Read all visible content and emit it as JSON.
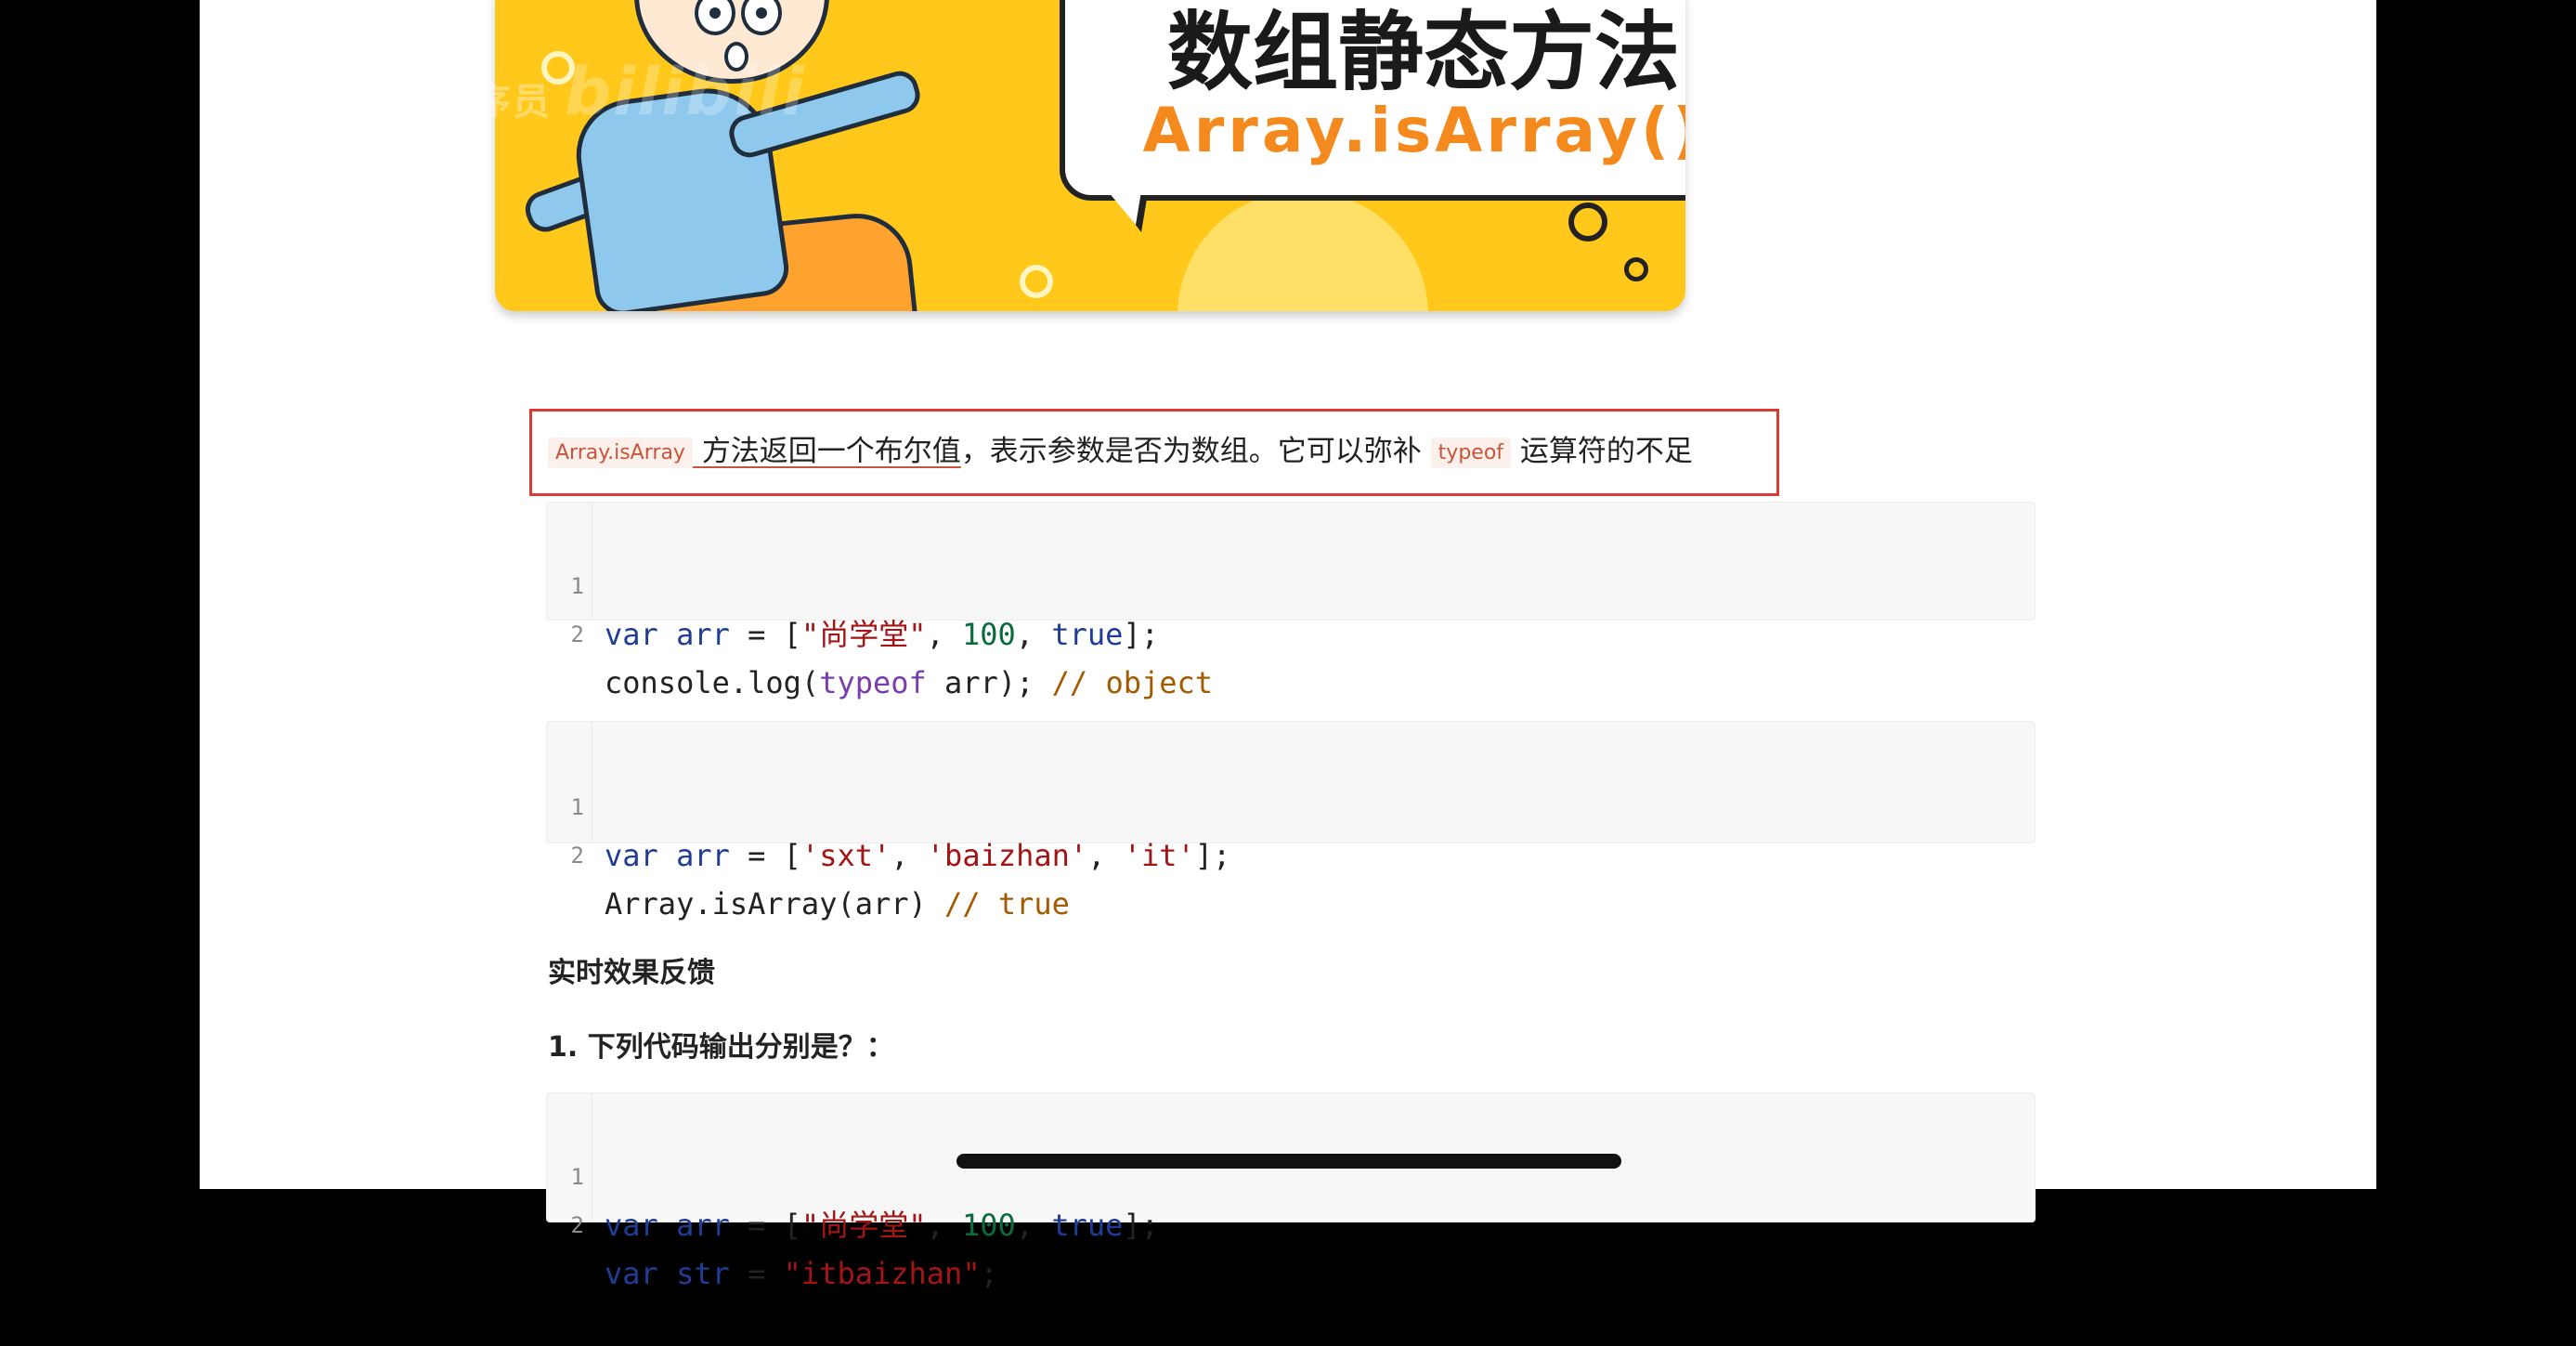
{
  "watermark": {
    "text": "尚学堂百战程序员",
    "brand": "bilibili"
  },
  "banner": {
    "title": "数组静态方法",
    "subtitle": "Array.isArray()"
  },
  "intro": {
    "chip1": "Array.isArray",
    "part1": "方法返回一个布尔值",
    "part2": "，表示参数是否为数组。它可以弥补",
    "chip2": "typeof",
    "part3": "运算符的不足"
  },
  "code_blocks": [
    {
      "lines": [
        {
          "n": "1",
          "tokens": [
            "var",
            " ",
            "arr",
            " = [",
            "\"尚学堂\"",
            ", ",
            "100",
            ", ",
            "true",
            "];"
          ]
        },
        {
          "n": "2",
          "tokens": [
            "console.log(",
            "typeof",
            " arr); ",
            "// object"
          ]
        }
      ]
    },
    {
      "lines": [
        {
          "n": "1",
          "tokens": [
            "var",
            " ",
            "arr",
            " = [",
            "'sxt'",
            ", ",
            "'baizhan'",
            ", ",
            "'it'",
            "];"
          ]
        },
        {
          "n": "2",
          "tokens": [
            "Array.isArray(arr) ",
            "// true"
          ]
        }
      ]
    },
    {
      "lines": [
        {
          "n": "1",
          "tokens": [
            "var",
            " ",
            "arr",
            " = [",
            "\"尚学堂\"",
            ", ",
            "100",
            ", ",
            "true",
            "];"
          ]
        },
        {
          "n": "2",
          "tokens": [
            "var",
            " ",
            "str",
            " = ",
            "\"itbaizhan\"",
            ";"
          ]
        }
      ]
    }
  ],
  "section": {
    "title": "实时效果反馈",
    "question": "1. 下列代码输出分别是？："
  },
  "colors": {
    "highlight_border": "#d83a34",
    "banner_bg": "#ffc81a",
    "subtitle": "#f48a1d"
  }
}
